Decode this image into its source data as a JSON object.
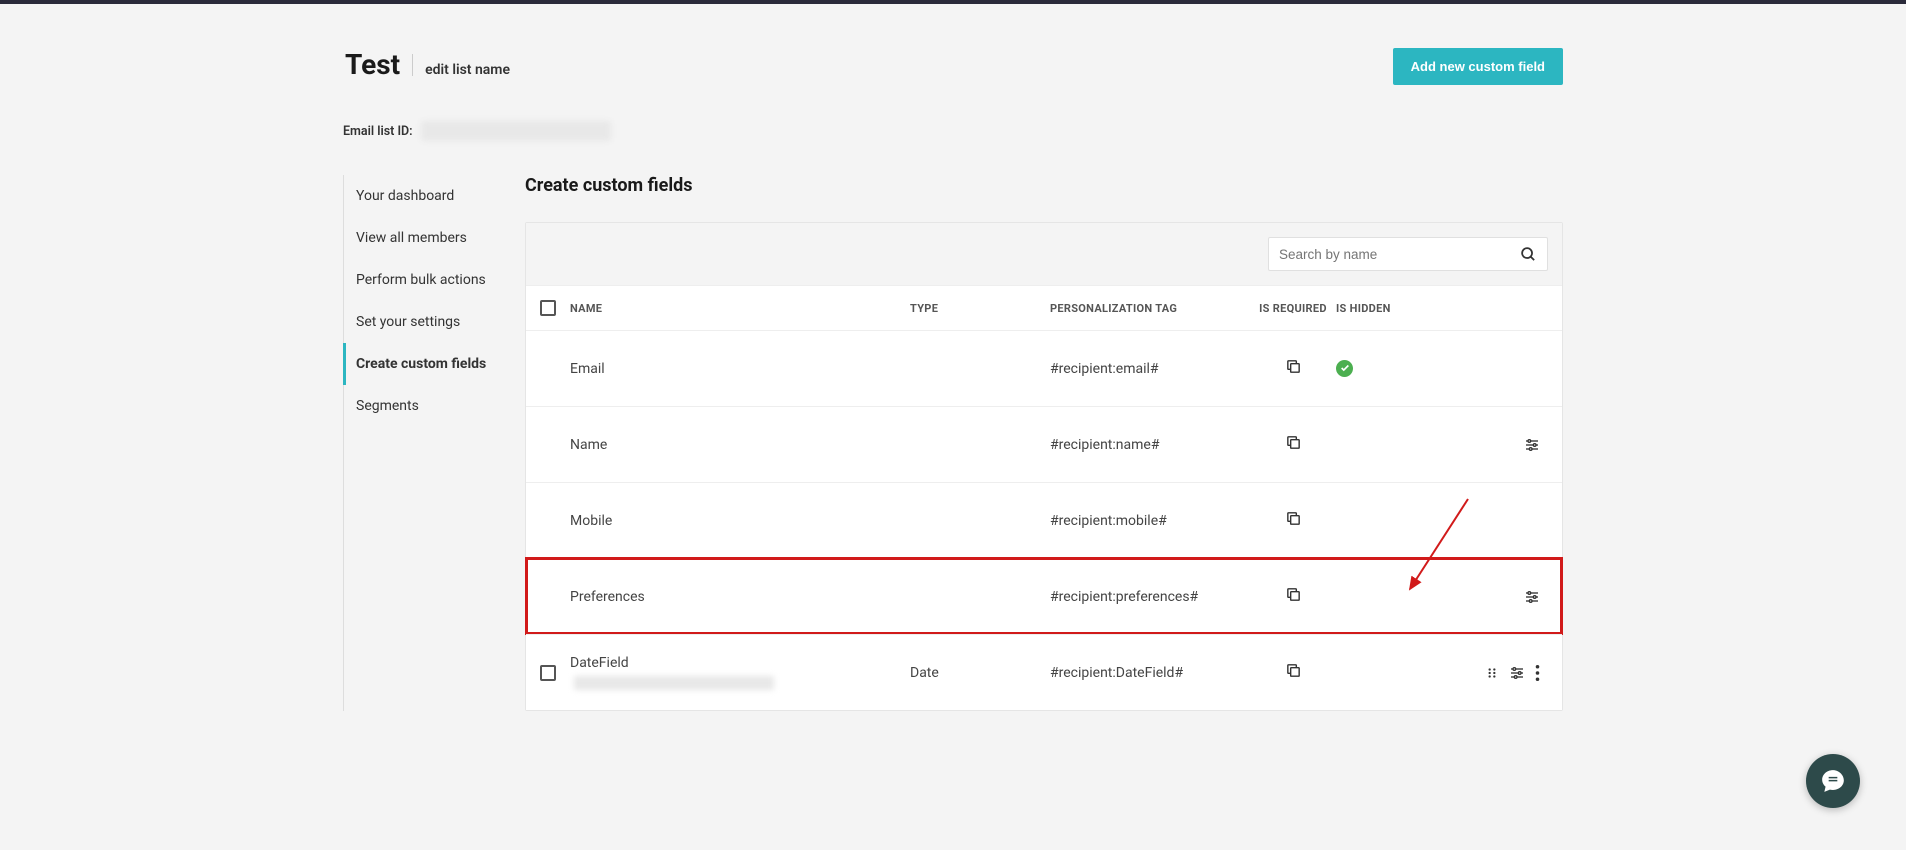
{
  "header": {
    "list_title": "Test",
    "edit_link": "edit list name",
    "add_button": "Add new custom field",
    "list_id_label": "Email list ID:"
  },
  "sidebar": {
    "items": [
      {
        "label": "Your dashboard",
        "active": false
      },
      {
        "label": "View all members",
        "active": false
      },
      {
        "label": "Perform bulk actions",
        "active": false
      },
      {
        "label": "Set your settings",
        "active": false
      },
      {
        "label": "Create custom fields",
        "active": true
      },
      {
        "label": "Segments",
        "active": false
      }
    ]
  },
  "content": {
    "section_title": "Create custom fields",
    "search_placeholder": "Search by name",
    "columns": {
      "name": "NAME",
      "type": "TYPE",
      "tag": "PERSONALIZATION TAG",
      "required": "IS REQUIRED",
      "hidden": "IS HIDDEN"
    },
    "rows": [
      {
        "name": "Email",
        "type": "",
        "tag": "#recipient:email#",
        "required": true,
        "has_checkbox": false,
        "has_tune": false,
        "highlighted": false,
        "has_drag": false,
        "has_more": false
      },
      {
        "name": "Name",
        "type": "",
        "tag": "#recipient:name#",
        "required": false,
        "has_checkbox": false,
        "has_tune": true,
        "highlighted": false,
        "has_drag": false,
        "has_more": false
      },
      {
        "name": "Mobile",
        "type": "",
        "tag": "#recipient:mobile#",
        "required": false,
        "has_checkbox": false,
        "has_tune": false,
        "highlighted": false,
        "has_drag": false,
        "has_more": false
      },
      {
        "name": "Preferences",
        "type": "",
        "tag": "#recipient:preferences#",
        "required": false,
        "has_checkbox": false,
        "has_tune": true,
        "highlighted": true,
        "has_drag": false,
        "has_more": false
      },
      {
        "name": "DateField",
        "type": "Date",
        "tag": "#recipient:DateField#",
        "required": false,
        "has_checkbox": true,
        "has_tune": true,
        "highlighted": false,
        "has_drag": true,
        "has_more": true,
        "has_blur_meta": true
      }
    ]
  }
}
